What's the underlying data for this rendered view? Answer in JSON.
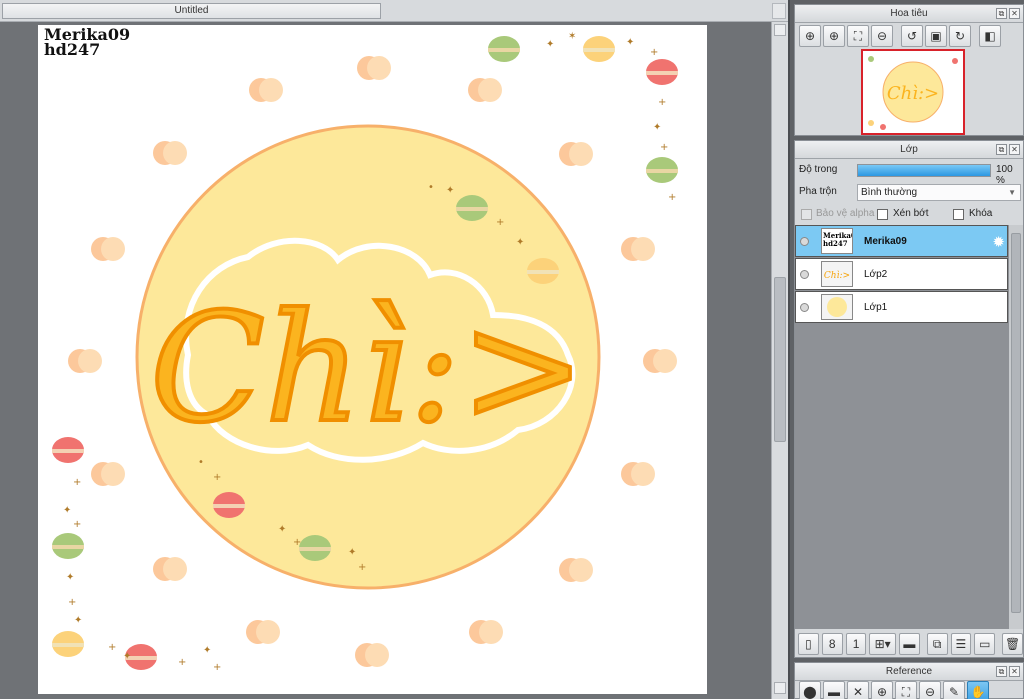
{
  "document": {
    "tab_title": "Untitled"
  },
  "canvas": {
    "signature_line1": "Merika09",
    "signature_line2": "hd247",
    "artwork_text": "Chì:>"
  },
  "navigator": {
    "title": "Hoa tiêu",
    "tools": [
      "zoom-actual-icon",
      "zoom-in-icon",
      "fit-icon",
      "zoom-out-icon",
      "rotate-left-icon",
      "rotate-reset-icon",
      "rotate-right-icon",
      "flip-icon"
    ]
  },
  "layers": {
    "title": "Lớp",
    "opacity_label": "Độ trong",
    "opacity_value": "100 %",
    "opacity_fraction": 1.0,
    "blend_label": "Pha trộn",
    "blend_value": "Bình thường",
    "protect_alpha_label": "Bảo vệ alpha",
    "clipping_label": "Xén bớt",
    "lock_label": "Khóa",
    "items": [
      {
        "name": "Merika09",
        "selected": true
      },
      {
        "name": "Lớp2",
        "selected": false
      },
      {
        "name": "Lớp1",
        "selected": false
      }
    ]
  },
  "reference": {
    "title": "Reference"
  },
  "colors": {
    "accent": "#3aa0e4",
    "selected_layer": "#7cc9f3",
    "circle_fill": "#fde89a",
    "circle_stroke": "#f5b169",
    "lettering": "#f7a40a"
  }
}
